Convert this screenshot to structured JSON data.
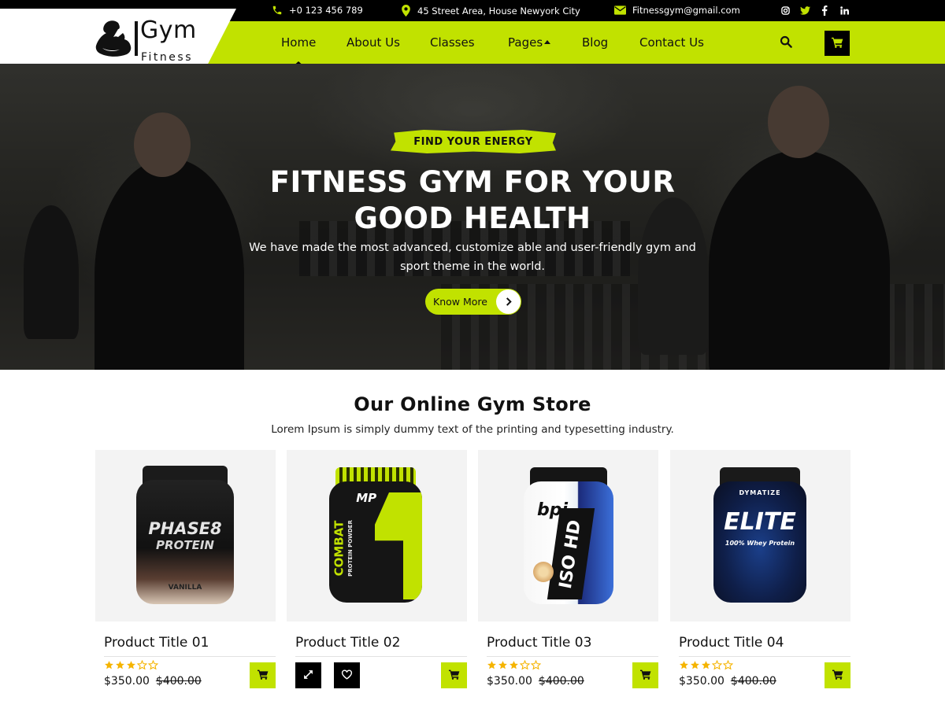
{
  "topbar": {
    "phone": "+0 123 456 789",
    "address": "45 Street Area, House Newyork City",
    "email": "Fitnessgym@gmail.com",
    "social": [
      "instagram-icon",
      "twitter-icon",
      "facebook-icon",
      "linkedin-icon"
    ]
  },
  "logo": {
    "title": "Gym",
    "subtitle": "Fitness"
  },
  "nav": {
    "items": [
      {
        "label": "Home",
        "active": true
      },
      {
        "label": "About Us"
      },
      {
        "label": "Classes"
      },
      {
        "label": "Pages"
      },
      {
        "label": "Blog"
      },
      {
        "label": "Contact Us"
      }
    ]
  },
  "hero": {
    "badge": "FIND YOUR ENERGY",
    "title_line1": "FITNESS GYM FOR YOUR",
    "title_line2": "GOOD HEALTH",
    "text_line1": "We have made the most advanced, customize able and user-friendly gym and",
    "text_line2": "sport theme in the world.",
    "button": "Know More"
  },
  "store": {
    "title": "Our Online Gym Store",
    "subtitle": "Lorem Ipsum is simply dummy text of the printing and typesetting industry.",
    "products": [
      {
        "title": "Product Title 01",
        "price": "$350.00",
        "old_price": "$400.00",
        "rating": 3,
        "brand": "PHASE8",
        "brand_sub": "PROTEIN",
        "flavor": "VANILLA"
      },
      {
        "title": "Product Title 02",
        "brand": "COMBAT",
        "brand_sub": "PROTEIN POWDER",
        "logo": "MP"
      },
      {
        "title": "Product Title 03",
        "price": "$350.00",
        "old_price": "$400.00",
        "rating": 3,
        "brand": "ISO HD",
        "logo": "bpi"
      },
      {
        "title": "Product Title 04",
        "price": "$350.00",
        "old_price": "$400.00",
        "rating": 3,
        "brand": "ELITE",
        "brand_sub": "100% Whey Protein",
        "logo": "DYMATIZE"
      }
    ]
  },
  "colors": {
    "accent": "#c1e200",
    "dark": "#000000",
    "star": "#f5b400"
  }
}
